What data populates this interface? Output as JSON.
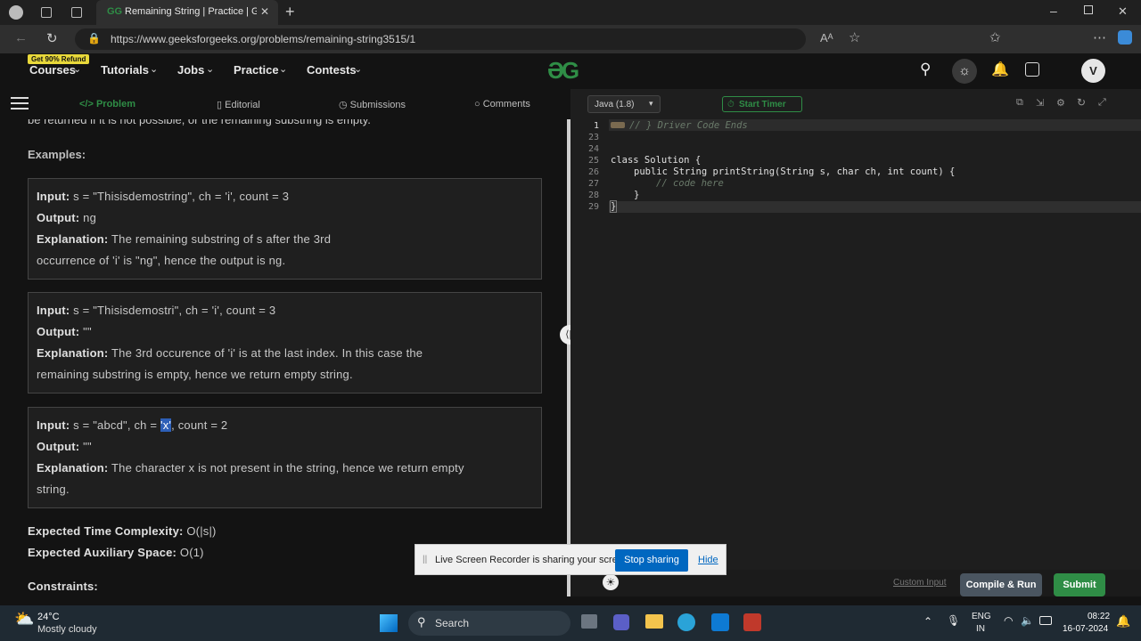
{
  "browser": {
    "tab_title": "Remaining String | Practice | Geeks",
    "url": "https://www.geeksforgeeks.org/problems/remaining-string3515/1"
  },
  "nav": {
    "promo": "Get 90% Refund",
    "items": [
      "Courses",
      "Tutorials",
      "Jobs",
      "Practice",
      "Contests"
    ],
    "avatar": "V"
  },
  "subnav": {
    "problem": "</> Problem",
    "editorial": "Editorial",
    "submissions": "Submissions",
    "comments": "Comments"
  },
  "problem": {
    "truncated": "be returned if it is not possible, or the remaining substring is empty.",
    "examples_heading": "Examples:",
    "examples": [
      {
        "input": "s = \"Thisisdemostring\", ch = 'i', count = 3",
        "output": "ng",
        "expl1": "The remaining substring of s after the 3rd",
        "expl2": "occurrence of 'i' is \"ng\", hence the output is ng."
      },
      {
        "input": "s = \"Thisisdemostri\", ch = 'i', count = 3",
        "output": "\"\"",
        "expl1": "The 3rd occurence of 'i' is at the last index. In this case the",
        "expl2": "remaining substring is empty, hence we return empty string."
      },
      {
        "input_a": "s = \"abcd\", ch = ",
        "input_sel": "'x'",
        "input_b": ", count = 2",
        "output": "\"\"",
        "expl1": "The character x is not present in the string, hence we return empty",
        "expl2": "string."
      }
    ],
    "labels": {
      "input": "Input:",
      "output": "Output:",
      "explanation": "Explanation:"
    },
    "time_label": "Expected Time Complexity:",
    "time_value": "O(|s|)",
    "space_label": "Expected Auxiliary Space:",
    "space_value": "O(1)",
    "constraints": "Constraints:"
  },
  "editor": {
    "language": "Java (1.8)",
    "start_timer": "Start Timer",
    "line_numbers": [
      "1",
      "23",
      "24",
      "25",
      "26",
      "27",
      "28",
      "29"
    ],
    "comment_top": "// } Driver Code Ends",
    "class_line": "class Solution {",
    "method_line": "public String printString(String s, char ch, int count) {",
    "code_here": "// code here",
    "close_inner": "}",
    "close_outer": "}",
    "custom_input": "Custom Input",
    "compile_run": "Compile & Run",
    "submit": "Submit"
  },
  "share_bar": {
    "text": "Live Screen Recorder is sharing your screen.",
    "stop": "Stop sharing",
    "hide": "Hide"
  },
  "taskbar": {
    "temp": "24°C",
    "weather": "Mostly cloudy",
    "search": "Search",
    "lang1": "ENG",
    "lang2": "IN",
    "time": "08:22",
    "date": "16-07-2024"
  },
  "colors": {
    "brand": "#2f8d46",
    "submit": "#2f8d46",
    "stop": "#0067c0"
  }
}
